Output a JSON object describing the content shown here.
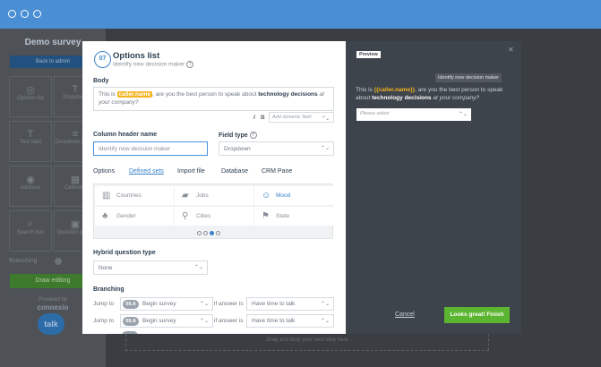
{
  "survey": {
    "title": "Demo survey",
    "back_label": "Back to admin",
    "tiles": [
      {
        "label": "Opinion list",
        "icon": "check-circle-icon"
      },
      {
        "label": "Dropdown",
        "icon": "text-icon"
      },
      {
        "label": "Text field",
        "icon": "text-field-icon"
      },
      {
        "label": "Dropdown group",
        "icon": "list-icon"
      },
      {
        "label": "Address",
        "icon": "location-icon"
      },
      {
        "label": "Calendar",
        "icon": "calendar-icon"
      },
      {
        "label": "Search box",
        "icon": "search-icon"
      },
      {
        "label": "Question group",
        "icon": "group-icon"
      }
    ],
    "branching_label": "Branching",
    "draw_label": "Draw editing",
    "powered_by": "Powered by",
    "brand": "connexio",
    "talk": "talk",
    "drop_hint": "Drag and drop your next step here"
  },
  "modal": {
    "step_number": "07",
    "title": "Options list",
    "subtitle": "Identify new decision maker",
    "body_label": "Body",
    "body_text": {
      "pre": "This is",
      "tag": "caller.name",
      "mid": ", are you the best person to speak about",
      "bold": "technology decisions",
      "post": "at your company?"
    },
    "format_italic": "I",
    "format_bold": "B",
    "dynamic_field_placeholder": "Add dynamic field",
    "column_header_label": "Column header name",
    "column_header_value": "Identify new decision maker",
    "field_type_label": "Field type",
    "field_type_value": "Dropdown",
    "tabs": [
      "Options",
      "Defined sets",
      "Import file",
      "Database",
      "CRM Pane"
    ],
    "active_tab": "Defined sets",
    "sets": [
      {
        "label": "Countries",
        "icon": "map-icon"
      },
      {
        "label": "Jobs",
        "icon": "briefcase-icon"
      },
      {
        "label": "Mood",
        "icon": "smile-icon",
        "selected": true
      },
      {
        "label": "Gender",
        "icon": "gender-icon"
      },
      {
        "label": "Cities",
        "icon": "pin-icon"
      },
      {
        "label": "State",
        "icon": "flag-icon"
      }
    ],
    "hybrid_label": "Hybrid question type",
    "hybrid_value": "None",
    "branching_label": "Branching",
    "branch_rows": [
      {
        "jump": "Jump to",
        "badge": "09.A",
        "target": "Begin survey",
        "cond": "if answer is",
        "answer": "Have time to talk"
      },
      {
        "jump": "Jump to",
        "badge": "09.A",
        "target": "Begin survey",
        "cond": "if answer is",
        "answer": "Have time to talk"
      }
    ]
  },
  "preview": {
    "label": "Preview",
    "subtitle": "Identify new decision maker",
    "text": {
      "pre": "This is",
      "tag": "{{caller.name}}",
      "mid": ", are you the best person to speak about",
      "bold": "technology decisions",
      "post": "at your company?"
    },
    "select_placeholder": "Please select",
    "cancel_label": "Cancel",
    "finish_label": "Looks great! Finish"
  },
  "colors": {
    "accent": "#3a83c9",
    "topbar": "#4a8fd4",
    "tag": "#f4b521",
    "finish": "#5cb531"
  }
}
